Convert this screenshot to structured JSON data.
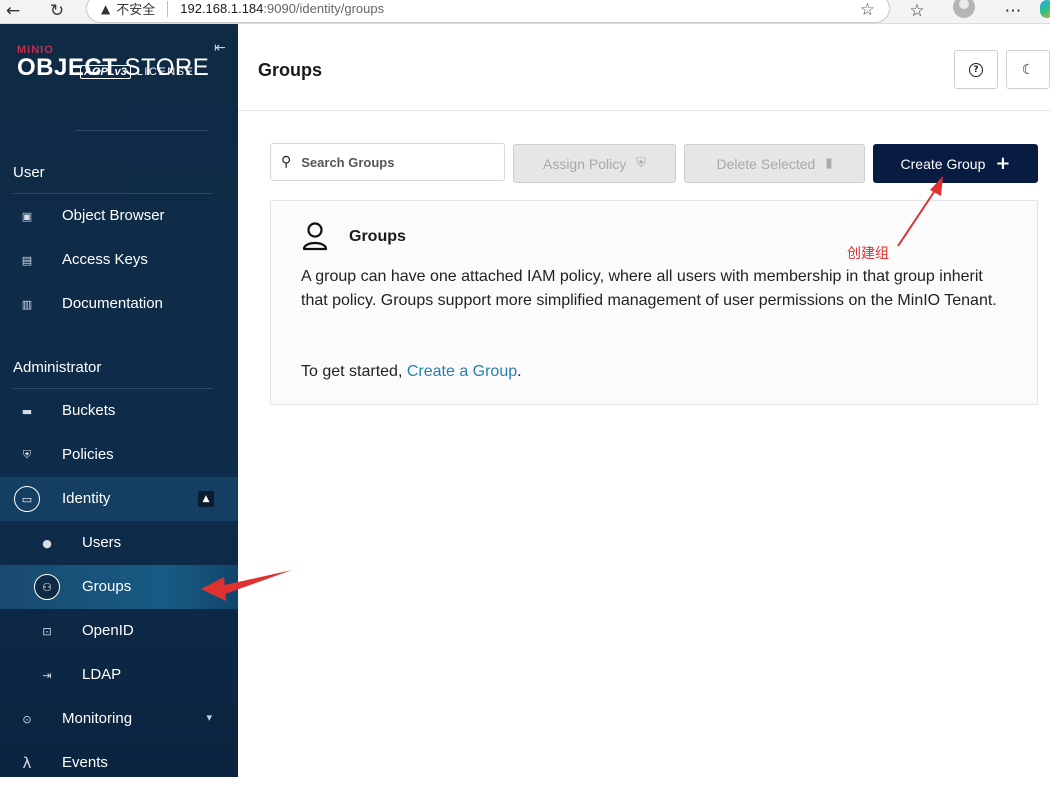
{
  "browser": {
    "insecure_label": "不安全",
    "url_host": "192.168.1.184",
    "url_path": ":9090/identity/groups"
  },
  "brand": {
    "minio": "MINIO",
    "title_bold": "OBJECT",
    "title_light": " STORE",
    "agpl": "AGPLv3",
    "license": "LICENSE"
  },
  "sidebar": {
    "user_section": "User",
    "admin_section": "Administrator",
    "user_items": [
      {
        "label": "Object Browser",
        "icon": "object-browser-icon"
      },
      {
        "label": "Access Keys",
        "icon": "access-keys-icon"
      },
      {
        "label": "Documentation",
        "icon": "documentation-icon"
      }
    ],
    "admin_items": [
      {
        "label": "Buckets",
        "icon": "bucket-icon"
      },
      {
        "label": "Policies",
        "icon": "shield-icon"
      },
      {
        "label": "Identity",
        "icon": "identity-icon"
      },
      {
        "label": "Users",
        "icon": "user-icon"
      },
      {
        "label": "Groups",
        "icon": "groups-icon"
      },
      {
        "label": "OpenID",
        "icon": "openid-icon"
      },
      {
        "label": "LDAP",
        "icon": "ldap-icon"
      },
      {
        "label": "Monitoring",
        "icon": "monitoring-icon"
      },
      {
        "label": "Events",
        "icon": "lambda-icon"
      }
    ]
  },
  "header": {
    "title": "Groups"
  },
  "toolbar": {
    "search_placeholder": "Search Groups",
    "assign_policy": "Assign Policy",
    "delete_selected": "Delete Selected",
    "create_group": "Create Group"
  },
  "card": {
    "title": "Groups",
    "description": "A group can have one attached IAM policy, where all users with membership in that group inherit that policy. Groups support more simplified management of user permissions on the MinIO Tenant.",
    "cta_prefix": "To get started, ",
    "cta_link": "Create a Group",
    "cta_suffix": "."
  },
  "annotation": {
    "label": "创建组",
    "color": "#e03131"
  },
  "colors": {
    "sidebar_bg": "#0f2a44",
    "primary_button": "#081c42",
    "link": "#2781b0",
    "brand_red": "#c72c48"
  }
}
